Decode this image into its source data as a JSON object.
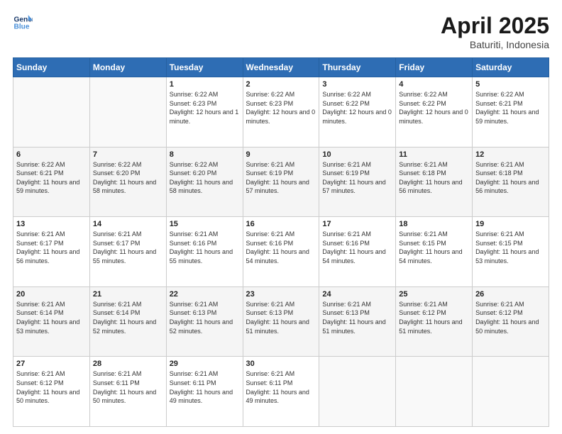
{
  "header": {
    "logo_line1": "General",
    "logo_line2": "Blue",
    "title": "April 2025",
    "subtitle": "Baturiti, Indonesia"
  },
  "days_of_week": [
    "Sunday",
    "Monday",
    "Tuesday",
    "Wednesday",
    "Thursday",
    "Friday",
    "Saturday"
  ],
  "weeks": [
    [
      {
        "day": "",
        "info": ""
      },
      {
        "day": "",
        "info": ""
      },
      {
        "day": "1",
        "info": "Sunrise: 6:22 AM\nSunset: 6:23 PM\nDaylight: 12 hours and 1 minute."
      },
      {
        "day": "2",
        "info": "Sunrise: 6:22 AM\nSunset: 6:23 PM\nDaylight: 12 hours and 0 minutes."
      },
      {
        "day": "3",
        "info": "Sunrise: 6:22 AM\nSunset: 6:22 PM\nDaylight: 12 hours and 0 minutes."
      },
      {
        "day": "4",
        "info": "Sunrise: 6:22 AM\nSunset: 6:22 PM\nDaylight: 12 hours and 0 minutes."
      },
      {
        "day": "5",
        "info": "Sunrise: 6:22 AM\nSunset: 6:21 PM\nDaylight: 11 hours and 59 minutes."
      }
    ],
    [
      {
        "day": "6",
        "info": "Sunrise: 6:22 AM\nSunset: 6:21 PM\nDaylight: 11 hours and 59 minutes."
      },
      {
        "day": "7",
        "info": "Sunrise: 6:22 AM\nSunset: 6:20 PM\nDaylight: 11 hours and 58 minutes."
      },
      {
        "day": "8",
        "info": "Sunrise: 6:22 AM\nSunset: 6:20 PM\nDaylight: 11 hours and 58 minutes."
      },
      {
        "day": "9",
        "info": "Sunrise: 6:21 AM\nSunset: 6:19 PM\nDaylight: 11 hours and 57 minutes."
      },
      {
        "day": "10",
        "info": "Sunrise: 6:21 AM\nSunset: 6:19 PM\nDaylight: 11 hours and 57 minutes."
      },
      {
        "day": "11",
        "info": "Sunrise: 6:21 AM\nSunset: 6:18 PM\nDaylight: 11 hours and 56 minutes."
      },
      {
        "day": "12",
        "info": "Sunrise: 6:21 AM\nSunset: 6:18 PM\nDaylight: 11 hours and 56 minutes."
      }
    ],
    [
      {
        "day": "13",
        "info": "Sunrise: 6:21 AM\nSunset: 6:17 PM\nDaylight: 11 hours and 56 minutes."
      },
      {
        "day": "14",
        "info": "Sunrise: 6:21 AM\nSunset: 6:17 PM\nDaylight: 11 hours and 55 minutes."
      },
      {
        "day": "15",
        "info": "Sunrise: 6:21 AM\nSunset: 6:16 PM\nDaylight: 11 hours and 55 minutes."
      },
      {
        "day": "16",
        "info": "Sunrise: 6:21 AM\nSunset: 6:16 PM\nDaylight: 11 hours and 54 minutes."
      },
      {
        "day": "17",
        "info": "Sunrise: 6:21 AM\nSunset: 6:16 PM\nDaylight: 11 hours and 54 minutes."
      },
      {
        "day": "18",
        "info": "Sunrise: 6:21 AM\nSunset: 6:15 PM\nDaylight: 11 hours and 54 minutes."
      },
      {
        "day": "19",
        "info": "Sunrise: 6:21 AM\nSunset: 6:15 PM\nDaylight: 11 hours and 53 minutes."
      }
    ],
    [
      {
        "day": "20",
        "info": "Sunrise: 6:21 AM\nSunset: 6:14 PM\nDaylight: 11 hours and 53 minutes."
      },
      {
        "day": "21",
        "info": "Sunrise: 6:21 AM\nSunset: 6:14 PM\nDaylight: 11 hours and 52 minutes."
      },
      {
        "day": "22",
        "info": "Sunrise: 6:21 AM\nSunset: 6:13 PM\nDaylight: 11 hours and 52 minutes."
      },
      {
        "day": "23",
        "info": "Sunrise: 6:21 AM\nSunset: 6:13 PM\nDaylight: 11 hours and 51 minutes."
      },
      {
        "day": "24",
        "info": "Sunrise: 6:21 AM\nSunset: 6:13 PM\nDaylight: 11 hours and 51 minutes."
      },
      {
        "day": "25",
        "info": "Sunrise: 6:21 AM\nSunset: 6:12 PM\nDaylight: 11 hours and 51 minutes."
      },
      {
        "day": "26",
        "info": "Sunrise: 6:21 AM\nSunset: 6:12 PM\nDaylight: 11 hours and 50 minutes."
      }
    ],
    [
      {
        "day": "27",
        "info": "Sunrise: 6:21 AM\nSunset: 6:12 PM\nDaylight: 11 hours and 50 minutes."
      },
      {
        "day": "28",
        "info": "Sunrise: 6:21 AM\nSunset: 6:11 PM\nDaylight: 11 hours and 50 minutes."
      },
      {
        "day": "29",
        "info": "Sunrise: 6:21 AM\nSunset: 6:11 PM\nDaylight: 11 hours and 49 minutes."
      },
      {
        "day": "30",
        "info": "Sunrise: 6:21 AM\nSunset: 6:11 PM\nDaylight: 11 hours and 49 minutes."
      },
      {
        "day": "",
        "info": ""
      },
      {
        "day": "",
        "info": ""
      },
      {
        "day": "",
        "info": ""
      }
    ]
  ]
}
